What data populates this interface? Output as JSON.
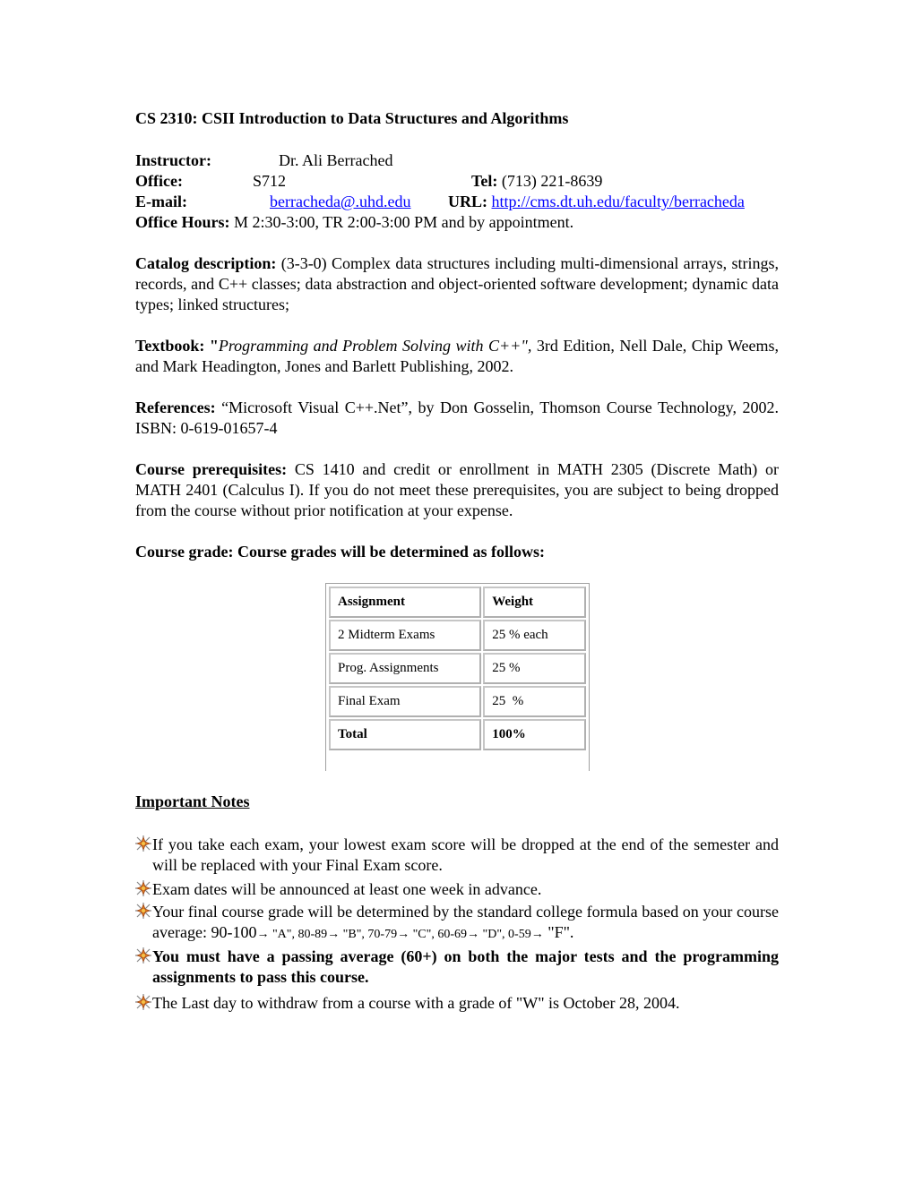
{
  "title": "CS 2310: CSII Introduction to Data Structures and Algorithms",
  "info": {
    "instructor_label": "Instructor:",
    "instructor_value": "Dr. Ali Berrached",
    "office_label": "Office:",
    "office_value": "S712",
    "tel_label": "Tel:",
    "tel_value": "(713) 221-8639",
    "email_label": "E-mail:",
    "email_value": "berracheda@.uhd.edu",
    "url_label": "URL:",
    "url_value": "http://cms.dt.uh.edu/faculty/berracheda",
    "hours_label": "Office Hours:",
    "hours_value": "M 2:30-3:00,  TR 2:00-3:00 PM  and by appointment."
  },
  "catalog": {
    "label": "Catalog description:",
    "text": "(3-3-0) Complex data structures including multi-dimensional arrays, strings, records, and C++ classes; data abstraction and object-oriented software development; dynamic data types; linked structures;"
  },
  "textbook": {
    "label": "Textbook: \"",
    "title": "Programming and Problem Solving with C++\",",
    "text": "3rd Edition, Nell Dale, Chip Weems, and Mark Headington, Jones and Barlett Publishing, 2002."
  },
  "references": {
    "label": "References:",
    "text": "“Microsoft Visual C++.Net”, by Don Gosselin, Thomson Course Technology, 2002. ISBN: 0-619-01657-4"
  },
  "prerequisites": {
    "label": "Course prerequisites:",
    "text": "CS 1410 and credit or enrollment in MATH 2305 (Discrete Math) or MATH 2401 (Calculus I). If you do not meet these prerequisites, you are subject to being dropped from the course without prior notification at your expense."
  },
  "grade_heading": "Course grade: Course grades will be determined as follows:",
  "grade_table": {
    "headers": [
      "Assignment",
      "Weight"
    ],
    "rows": [
      [
        "2 Midterm Exams",
        "25 % each"
      ],
      [
        "Prog. Assignments",
        "25 %"
      ],
      [
        "Final Exam",
        "25  %"
      ]
    ],
    "total": [
      "Total",
      "100%"
    ]
  },
  "notes_heading": "Important Notes",
  "bullet_icon": "starburst-bullet-icon",
  "notes": [
    "If you take each exam, your lowest exam score will be dropped at the end of the semester and will be replaced with your Final Exam score.",
    "Exam dates will be announced at least one week in advance.",
    "Your final course grade will be determined by the standard college formula based on your course average:",
    "You must have a passing average (60+) on both the major tests and the programming assignments to pass this course.",
    "The Last day to withdraw from a course with a grade of \"W\" is October 28, 2004."
  ],
  "grade_scale": {
    "first": "90-100",
    "middle": "→ \"A\", 80-89→ \"B\", 70-79→ \"C\", 60-69→ \"D\", 0-59→",
    "last": "\"F\"."
  }
}
